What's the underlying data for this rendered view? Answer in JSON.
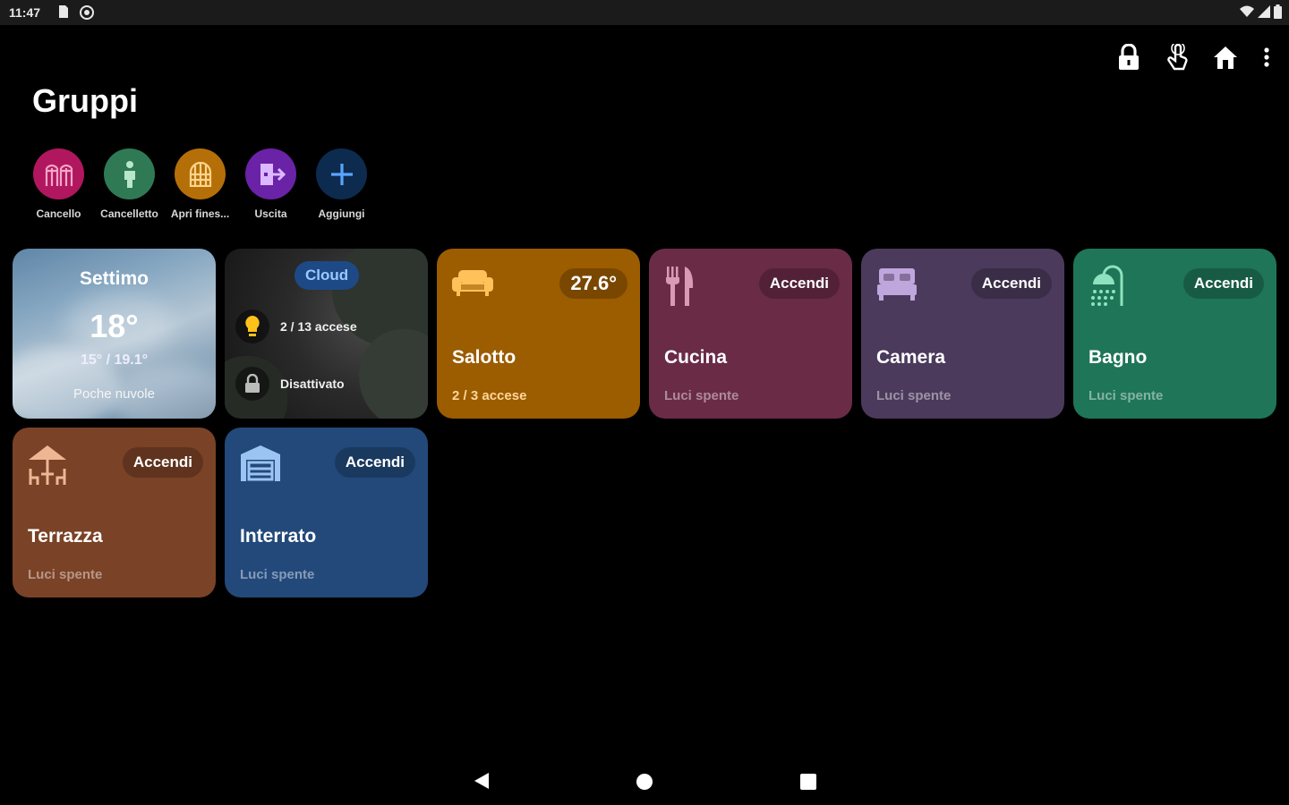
{
  "statusbar": {
    "time": "11:47"
  },
  "page": {
    "title": "Gruppi"
  },
  "shortcuts": [
    {
      "label": "Cancello",
      "icon": "gate-icon",
      "color": "#b0175f"
    },
    {
      "label": "Cancelletto",
      "icon": "person-icon",
      "color": "#2f7a55"
    },
    {
      "label": "Apri fines...",
      "icon": "window-icon",
      "color": "#b56f08"
    },
    {
      "label": "Uscita",
      "icon": "exit-icon",
      "color": "#6a22a6"
    },
    {
      "label": "Aggiungi",
      "icon": "plus-icon",
      "color": "#0d2b4f"
    }
  ],
  "weather": {
    "city": "Settimo",
    "temp": "18°",
    "range": "15° / 19.1°",
    "desc": "Poche nuvole"
  },
  "cloud": {
    "badge": "Cloud",
    "lights": "2 / 13 accese",
    "lock": "Disattivato"
  },
  "rooms": [
    {
      "name": "Salotto",
      "status": "2 / 3 accese",
      "pill": "27.6°",
      "icon": "sofa-icon",
      "color": "#9c5c00"
    },
    {
      "name": "Cucina",
      "status": "Luci spente",
      "pill": "Accendi",
      "icon": "cutlery-icon",
      "color": "#6a2b47"
    },
    {
      "name": "Camera",
      "status": "Luci spente",
      "pill": "Accendi",
      "icon": "bed-icon",
      "color": "#4b3a5c"
    },
    {
      "name": "Bagno",
      "status": "Luci spente",
      "pill": "Accendi",
      "icon": "shower-icon",
      "color": "#1f7558"
    },
    {
      "name": "Terrazza",
      "status": "Luci spente",
      "pill": "Accendi",
      "icon": "terrace-icon",
      "color": "#7a4226"
    },
    {
      "name": "Interrato",
      "status": "Luci spente",
      "pill": "Accendi",
      "icon": "garage-icon",
      "color": "#22497a"
    }
  ]
}
